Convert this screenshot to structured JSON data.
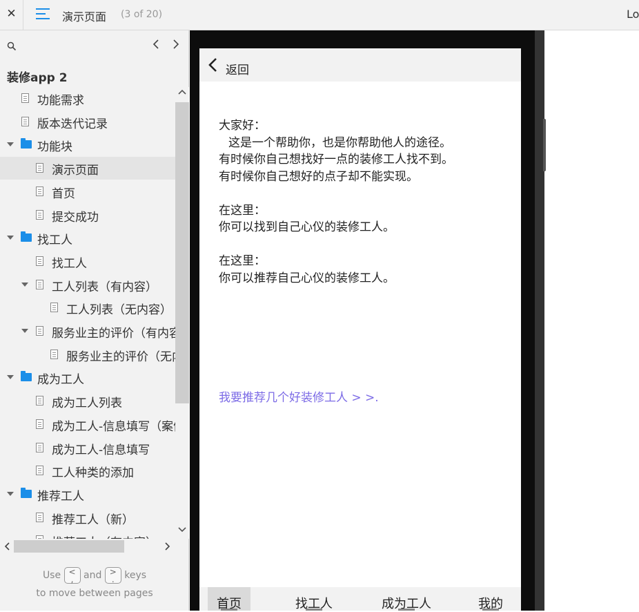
{
  "topbar": {
    "close_glyph": "✕",
    "menu_icon": "hamburger-icon",
    "page_title": "演示页面",
    "page_count": "(3 of 20)",
    "right_text": "Lo"
  },
  "sidebar": {
    "project_name": "装修app 2",
    "tree": [
      {
        "label": "功能需求",
        "type": "page",
        "level": 0
      },
      {
        "label": "版本迭代记录",
        "type": "page",
        "level": 0
      },
      {
        "label": "功能块",
        "type": "folder",
        "level": 0,
        "expanded": true
      },
      {
        "label": "演示页面",
        "type": "page",
        "level": 1,
        "selected": true
      },
      {
        "label": "首页",
        "type": "page",
        "level": 1
      },
      {
        "label": "提交成功",
        "type": "page",
        "level": 1
      },
      {
        "label": "找工人",
        "type": "folder",
        "level": 0,
        "expanded": true
      },
      {
        "label": "找工人",
        "type": "page",
        "level": 1
      },
      {
        "label": "工人列表（有内容）",
        "type": "page",
        "level": 1,
        "expanded": true
      },
      {
        "label": "工人列表（无内容）",
        "type": "page",
        "level": 2
      },
      {
        "label": "服务业主的评价（有内容）",
        "type": "page",
        "level": 1,
        "expanded": true
      },
      {
        "label": "服务业主的评价（无内容）",
        "type": "page",
        "level": 2
      },
      {
        "label": "成为工人",
        "type": "folder",
        "level": 0,
        "expanded": true
      },
      {
        "label": "成为工人列表",
        "type": "page",
        "level": 1
      },
      {
        "label": "成为工人-信息填写（案例）",
        "type": "page",
        "level": 1
      },
      {
        "label": "成为工人-信息填写",
        "type": "page",
        "level": 1
      },
      {
        "label": "工人种类的添加",
        "type": "page",
        "level": 1
      },
      {
        "label": "推荐工人",
        "type": "folder",
        "level": 0,
        "expanded": true
      },
      {
        "label": "推荐工人（新）",
        "type": "page",
        "level": 1
      },
      {
        "label": "推荐工人（有内容）",
        "type": "page",
        "level": 1
      }
    ],
    "hint": {
      "use": "Use",
      "and": "and",
      "keys": "keys",
      "line2": "to move between pages",
      "prev_key": "<\n,",
      "next_key": ">\n."
    }
  },
  "screen": {
    "back_label": "返回",
    "paragraphs": [
      [
        "大家好：",
        "这是一个帮助你，也是你帮助他人的途径。",
        "有时候你自己想找好一点的装修工人找不到。",
        "有时候你自己想好的点子却不能实现。"
      ],
      [
        "在这里：",
        "你可以找到自己心仪的装修工人。"
      ],
      [
        "在这里：",
        "你可以推荐自己心仪的装修工人。"
      ]
    ],
    "link": "我要推荐几个好装修工人 > >.",
    "link_color": "#7c6be6",
    "tabs": [
      "首页",
      "找工人",
      "成为工人",
      "我的"
    ]
  },
  "colors": {
    "accent": "#1b8ee8"
  }
}
